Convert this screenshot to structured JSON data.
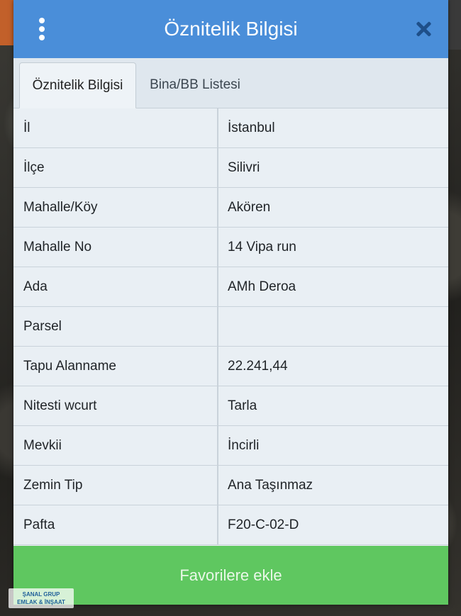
{
  "header": {
    "title": "Öznitelik Bilgisi",
    "menu_icon": "more-vertical-icon",
    "close_icon": "close-icon"
  },
  "tabs": [
    {
      "label": "Öznitelik Bilgisi",
      "active": true
    },
    {
      "label": "Bina/BB Listesi",
      "active": false
    }
  ],
  "attributes": [
    {
      "key": "İl",
      "value": "İstanbul"
    },
    {
      "key": "İlçe",
      "value": "Silivri"
    },
    {
      "key": "Mahalle/Köy",
      "value": "Akören"
    },
    {
      "key": "Mahalle No",
      "value": "14 Vipa run"
    },
    {
      "key": "Ada",
      "value": "AMh Deroa"
    },
    {
      "key": "Parsel",
      "value": ""
    },
    {
      "key": "Tapu Alanname",
      "value": "22.241,44"
    },
    {
      "key": "Nitesti wcurt",
      "value": "Tarla"
    },
    {
      "key": "Mevkii",
      "value": "İncirli"
    },
    {
      "key": "Zemin Tip",
      "value": "Ana Taşınmaz"
    },
    {
      "key": "Pafta",
      "value": "F20-C-02-D"
    }
  ],
  "footer": {
    "favorite_button": "Favorilere ekle"
  },
  "watermark_logo": {
    "line1": "ŞANAL GRUP",
    "line2": "EMLAK & İNŞAAT"
  },
  "colors": {
    "header": "#4a8ed9",
    "button": "#5fc760"
  }
}
